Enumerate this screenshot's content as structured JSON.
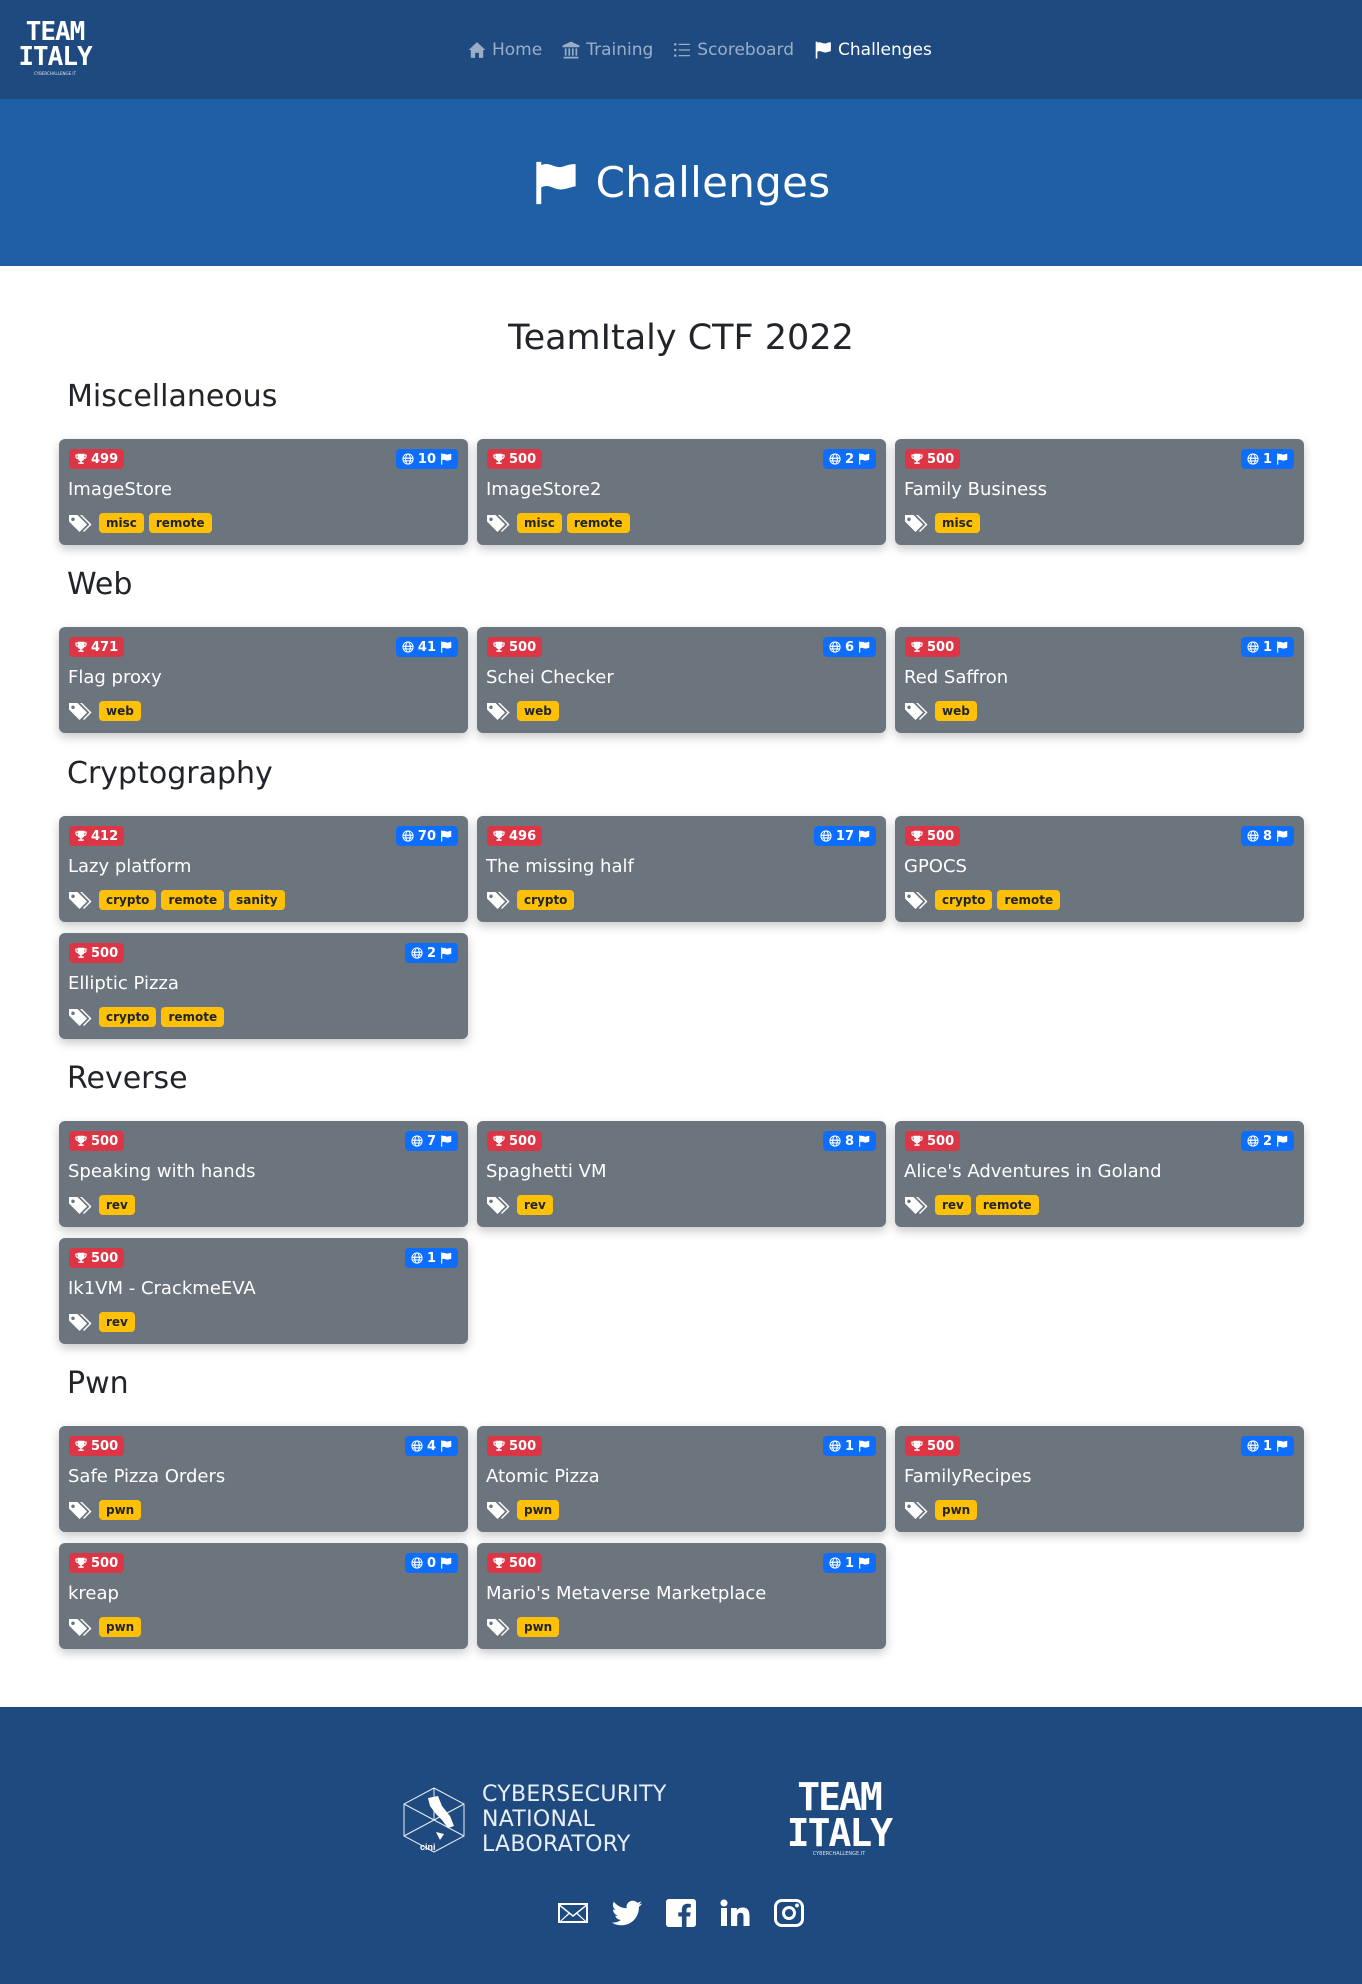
{
  "brand": {
    "logo_line1": "TEAM",
    "logo_line2": "ITALY",
    "logo_sub": "CYBERCHALLENGE.IT"
  },
  "nav": {
    "items": [
      {
        "label": "Home",
        "icon": "home-icon"
      },
      {
        "label": "Training",
        "icon": "bank-icon"
      },
      {
        "label": "Scoreboard",
        "icon": "list-icon"
      },
      {
        "label": "Challenges",
        "icon": "flag-icon",
        "active": true
      }
    ]
  },
  "hero": {
    "title": "Challenges",
    "icon": "flag-icon"
  },
  "ctf_title": "TeamItaly CTF 2022",
  "categories": [
    {
      "title": "Miscellaneous",
      "challenges": [
        {
          "name": "ImageStore",
          "points": "499",
          "solves": "10",
          "tags": [
            "misc",
            "remote"
          ]
        },
        {
          "name": "ImageStore2",
          "points": "500",
          "solves": "2",
          "tags": [
            "misc",
            "remote"
          ]
        },
        {
          "name": "Family Business",
          "points": "500",
          "solves": "1",
          "tags": [
            "misc"
          ]
        }
      ]
    },
    {
      "title": "Web",
      "challenges": [
        {
          "name": "Flag proxy",
          "points": "471",
          "solves": "41",
          "tags": [
            "web"
          ]
        },
        {
          "name": "Schei Checker",
          "points": "500",
          "solves": "6",
          "tags": [
            "web"
          ]
        },
        {
          "name": "Red Saffron",
          "points": "500",
          "solves": "1",
          "tags": [
            "web"
          ]
        }
      ]
    },
    {
      "title": "Cryptography",
      "challenges": [
        {
          "name": "Lazy platform",
          "points": "412",
          "solves": "70",
          "tags": [
            "crypto",
            "remote",
            "sanity"
          ]
        },
        {
          "name": "The missing half",
          "points": "496",
          "solves": "17",
          "tags": [
            "crypto"
          ]
        },
        {
          "name": "GPOCS",
          "points": "500",
          "solves": "8",
          "tags": [
            "crypto",
            "remote"
          ]
        },
        {
          "name": "Elliptic Pizza",
          "points": "500",
          "solves": "2",
          "tags": [
            "crypto",
            "remote"
          ]
        }
      ]
    },
    {
      "title": "Reverse",
      "challenges": [
        {
          "name": "Speaking with hands",
          "points": "500",
          "solves": "7",
          "tags": [
            "rev"
          ]
        },
        {
          "name": "Spaghetti VM",
          "points": "500",
          "solves": "8",
          "tags": [
            "rev"
          ]
        },
        {
          "name": "Alice's Adventures in Goland",
          "points": "500",
          "solves": "2",
          "tags": [
            "rev",
            "remote"
          ]
        },
        {
          "name": "Ik1VM - CrackmeEVA",
          "points": "500",
          "solves": "1",
          "tags": [
            "rev"
          ]
        }
      ]
    },
    {
      "title": "Pwn",
      "challenges": [
        {
          "name": "Safe Pizza Orders",
          "points": "500",
          "solves": "4",
          "tags": [
            "pwn"
          ]
        },
        {
          "name": "Atomic Pizza",
          "points": "500",
          "solves": "1",
          "tags": [
            "pwn"
          ]
        },
        {
          "name": "FamilyRecipes",
          "points": "500",
          "solves": "1",
          "tags": [
            "pwn"
          ]
        },
        {
          "name": "kreap",
          "points": "500",
          "solves": "0",
          "tags": [
            "pwn"
          ]
        },
        {
          "name": "Mario's Metaverse Marketplace",
          "points": "500",
          "solves": "1",
          "tags": [
            "pwn"
          ]
        }
      ]
    }
  ],
  "footer": {
    "cnl_line1": "CYBERSECURITY",
    "cnl_line2": "NATIONAL",
    "cnl_line3": "LABORATORY",
    "cnl_badge": "cini",
    "socials": [
      "mail-icon",
      "twitter-icon",
      "facebook-icon",
      "linkedin-icon",
      "instagram-icon"
    ]
  },
  "colors": {
    "navbar": "#1e4a80",
    "hero": "#1f5fa6",
    "card": "#6c757d",
    "points_badge": "#dc3545",
    "solves_badge": "#0d6efd",
    "tag": "#ffc107"
  }
}
